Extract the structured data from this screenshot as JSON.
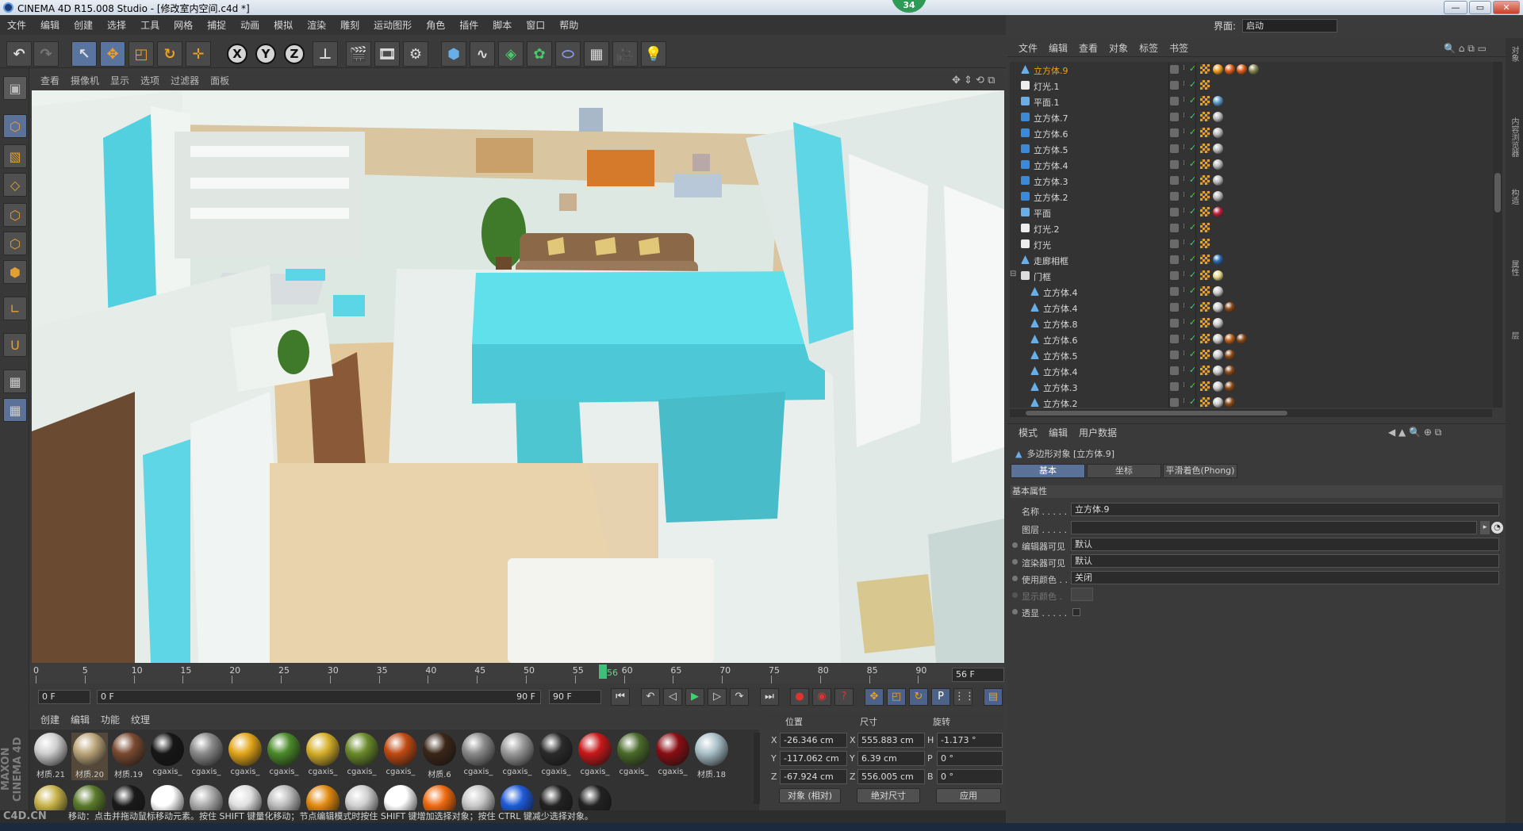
{
  "window": {
    "title": "CINEMA 4D R15.008 Studio - [修改室内空间.c4d *]",
    "badge": "34",
    "min": "—",
    "max": "▭",
    "close": "✕"
  },
  "menubar": [
    "文件",
    "编辑",
    "创建",
    "选择",
    "工具",
    "网格",
    "捕捉",
    "动画",
    "模拟",
    "渲染",
    "雕刻",
    "运动图形",
    "角色",
    "插件",
    "脚本",
    "窗口",
    "帮助"
  ],
  "layout": {
    "label": "界面:",
    "value": "启动"
  },
  "viewport_menu": [
    "查看",
    "摄像机",
    "显示",
    "选项",
    "过滤器",
    "面板"
  ],
  "toolbar_icons": [
    "undo-icon",
    "redo-icon",
    "select-icon",
    "move-icon",
    "scale-icon",
    "rotate-icon",
    "move-all-icon"
  ],
  "axis_labels": [
    "X",
    "Y",
    "Z"
  ],
  "timeline": {
    "ticks": [
      "0",
      "5",
      "10",
      "15",
      "20",
      "25",
      "30",
      "35",
      "40",
      "45",
      "50",
      "55",
      "60",
      "65",
      "70",
      "75",
      "80",
      "85",
      "90"
    ],
    "current": "56",
    "end_field": "56 F",
    "start": "0 F",
    "range_start": "0 F",
    "range_end": "90 F",
    "end": "90 F"
  },
  "material_menu": [
    "创建",
    "编辑",
    "功能",
    "纹理"
  ],
  "materials": [
    {
      "label": "材质.21",
      "color": "#cfcfcf"
    },
    {
      "label": "材质.20",
      "color": "#bba57a"
    },
    {
      "label": "材质.19",
      "color": "#7a4a30"
    },
    {
      "label": "cgaxis_",
      "color": "#161616"
    },
    {
      "label": "cgaxis_",
      "color": "#8a8a8a"
    },
    {
      "label": "cgaxis_",
      "color": "#e3a61a"
    },
    {
      "label": "cgaxis_",
      "color": "#4b8a2a"
    },
    {
      "label": "cgaxis_",
      "color": "#d6b02a"
    },
    {
      "label": "cgaxis_",
      "color": "#6a8a2a"
    },
    {
      "label": "cgaxis_",
      "color": "#c04a12"
    },
    {
      "label": "材质.6",
      "color": "#3b2618"
    },
    {
      "label": "cgaxis_",
      "color": "#8a8a8a"
    },
    {
      "label": "cgaxis_",
      "color": "#9a9a9a"
    },
    {
      "label": "cgaxis_",
      "color": "#2a2a2a"
    },
    {
      "label": "cgaxis_",
      "color": "#c8181a"
    },
    {
      "label": "cgaxis_",
      "color": "#4a6a2a"
    },
    {
      "label": "cgaxis_",
      "color": "#8a0e14"
    },
    {
      "label": "材质.18",
      "color": "#a9c0c8"
    }
  ],
  "materials_row2": [
    "#c7b34a",
    "#5a7a2a",
    "#1a1a1a",
    "#ffffff",
    "#aaaaaa",
    "#e0e0e0",
    "#bbbbbb",
    "#e08a10",
    "#d0d0d0",
    "#ffffff",
    "#f06a10",
    "#c8c8c8",
    "#1e5ad8",
    "#222222",
    "#222222"
  ],
  "coords": {
    "headers": [
      "位置",
      "尺寸",
      "旋转"
    ],
    "rows": [
      {
        "axis": "X",
        "pos": "-26.346 cm",
        "size_axis": "X",
        "size": "555.883 cm",
        "rot_axis": "H",
        "rot": "-1.173 °"
      },
      {
        "axis": "Y",
        "pos": "-117.062 cm",
        "size_axis": "Y",
        "size": "6.39 cm",
        "rot_axis": "P",
        "rot": "0 °"
      },
      {
        "axis": "Z",
        "pos": "-67.924 cm",
        "size_axis": "Z",
        "size": "556.005 cm",
        "rot_axis": "B",
        "rot": "0 °"
      }
    ],
    "mode": "对象 (相对)",
    "size_mode": "绝对尺寸",
    "apply": "应用"
  },
  "status": "移动：点击并拖动鼠标移动元素。按住 SHIFT 键量化移动；节点编辑模式时按住 SHIFT 键增加选择对象；按住 CTRL 键减少选择对象。",
  "brand": {
    "maxon": "MAXON CINEMA 4D",
    "site": "C4D.CN"
  },
  "object_manager": {
    "menu": [
      "文件",
      "编辑",
      "查看",
      "对象",
      "标签",
      "书签"
    ],
    "objects": [
      {
        "name": "立方体.9",
        "type": "poly",
        "indent": 0,
        "selected": true,
        "tags": [
          "#f0a020",
          "#e0601a",
          "#e0601a",
          "#888855"
        ]
      },
      {
        "name": "灯光.1",
        "type": "light",
        "indent": 0,
        "tags": []
      },
      {
        "name": "平面.1",
        "type": "plane",
        "indent": 0,
        "tags": [
          "#5b9bc8"
        ]
      },
      {
        "name": "立方体.7",
        "type": "cube",
        "indent": 0,
        "tags": [
          "#bbbbbb"
        ]
      },
      {
        "name": "立方体.6",
        "type": "cube",
        "indent": 0,
        "tags": [
          "#bbbbbb"
        ]
      },
      {
        "name": "立方体.5",
        "type": "cube",
        "indent": 0,
        "tags": [
          "#bbbbbb"
        ]
      },
      {
        "name": "立方体.4",
        "type": "cube",
        "indent": 0,
        "tags": [
          "#bbbbbb"
        ]
      },
      {
        "name": "立方体.3",
        "type": "cube",
        "indent": 0,
        "tags": [
          "#bbbbbb"
        ]
      },
      {
        "name": "立方体.2",
        "type": "cube",
        "indent": 0,
        "tags": [
          "#bbbbbb"
        ]
      },
      {
        "name": "平面",
        "type": "plane",
        "indent": 0,
        "tags": [
          "#c0203a"
        ]
      },
      {
        "name": "灯光.2",
        "type": "light",
        "indent": 0,
        "tags": []
      },
      {
        "name": "灯光",
        "type": "light",
        "indent": 0,
        "tags": []
      },
      {
        "name": "走廊相框",
        "type": "poly",
        "indent": 0,
        "tags": [
          "#2a6ab0"
        ]
      },
      {
        "name": "门框",
        "type": "null",
        "indent": 0,
        "tags": [
          "#e8d88a"
        ]
      },
      {
        "name": "立方体.4",
        "type": "poly",
        "indent": 1,
        "tags": [
          "#cccccc"
        ]
      },
      {
        "name": "立方体.4",
        "type": "poly",
        "indent": 1,
        "tags": [
          "#cccccc",
          "#8a4a1a"
        ]
      },
      {
        "name": "立方体.8",
        "type": "poly",
        "indent": 1,
        "tags": [
          "#cccccc"
        ]
      },
      {
        "name": "立方体.6",
        "type": "poly",
        "indent": 1,
        "tags": [
          "#cccccc",
          "#c0601a",
          "#8a4a1a"
        ]
      },
      {
        "name": "立方体.5",
        "type": "poly",
        "indent": 1,
        "tags": [
          "#cccccc",
          "#8a4a1a"
        ]
      },
      {
        "name": "立方体.4",
        "type": "poly",
        "indent": 1,
        "tags": [
          "#cccccc",
          "#8a4a1a"
        ]
      },
      {
        "name": "立方体.3",
        "type": "poly",
        "indent": 1,
        "tags": [
          "#cccccc",
          "#8a4a1a"
        ]
      },
      {
        "name": "立方体.2",
        "type": "poly",
        "indent": 1,
        "tags": [
          "#cccccc",
          "#8a4a1a"
        ]
      }
    ]
  },
  "attribute_manager": {
    "menu": [
      "模式",
      "编辑",
      "用户数据"
    ],
    "object": "多边形对象 [立方体.9]",
    "tabs": [
      "基本",
      "坐标",
      "平滑着色(Phong)"
    ],
    "section": "基本属性",
    "fields": [
      {
        "label": "名称 . . . . .",
        "value": "立方体.9"
      },
      {
        "label": "图层 . . . . .",
        "value": ""
      },
      {
        "label": "编辑器可见",
        "value": "默认"
      },
      {
        "label": "渲染器可见",
        "value": "默认"
      },
      {
        "label": "使用颜色 . .",
        "value": "关闭"
      },
      {
        "label": "显示颜色 .",
        "value": ""
      },
      {
        "label": "透显 . . . . .",
        "value": ""
      }
    ]
  },
  "side_tabs": [
    "对象",
    "内容浏览器",
    "构造",
    "属性",
    "层"
  ]
}
